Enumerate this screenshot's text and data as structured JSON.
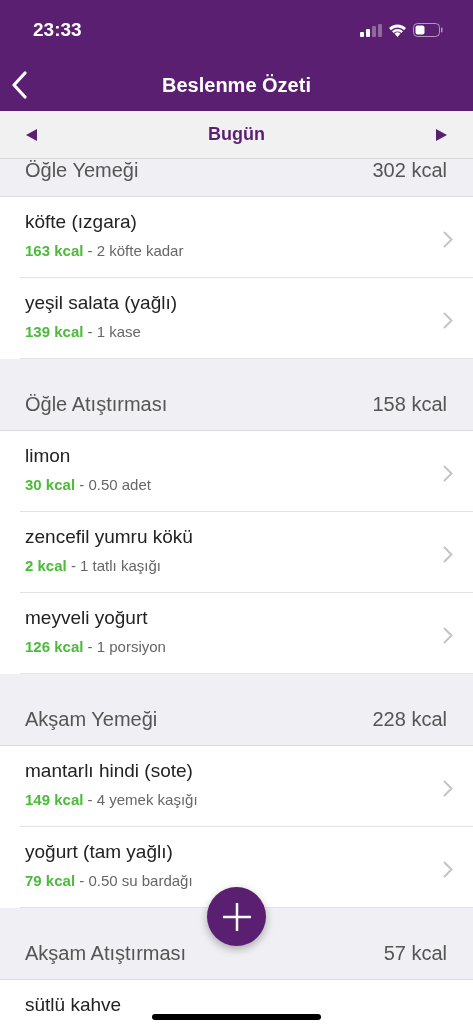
{
  "status_bar": {
    "time": "23:33"
  },
  "nav": {
    "title": "Beslenme Özeti"
  },
  "date_bar": {
    "label": "Bugün"
  },
  "sections": [
    {
      "title": "Öğle Yemeği",
      "total": "302 kcal",
      "items": [
        {
          "name": "köfte (ızgara)",
          "kcal": "163 kcal",
          "amount": "- 2 köfte kadar"
        },
        {
          "name": "yeşil salata (yağlı)",
          "kcal": "139 kcal",
          "amount": "- 1 kase"
        }
      ]
    },
    {
      "title": "Öğle Atıştırması",
      "total": "158 kcal",
      "items": [
        {
          "name": "limon",
          "kcal": "30 kcal",
          "amount": "- 0.50 adet"
        },
        {
          "name": "zencefil yumru kökü",
          "kcal": "2 kcal",
          "amount": "- 1 tatlı kaşığı"
        },
        {
          "name": "meyveli yoğurt",
          "kcal": "126 kcal",
          "amount": "- 1 porsiyon"
        }
      ]
    },
    {
      "title": "Akşam Yemeği",
      "total": "228 kcal",
      "items": [
        {
          "name": "mantarlı hindi (sote)",
          "kcal": "149 kcal",
          "amount": "- 4 yemek kaşığı"
        },
        {
          "name": "yoğurt (tam yağlı)",
          "kcal": "79 kcal",
          "amount": "- 0.50 su bardağı"
        }
      ]
    },
    {
      "title": "Akşam Atıştırması",
      "total": "57 kcal",
      "items": [
        {
          "name": "sütlü kahve"
        }
      ]
    }
  ]
}
